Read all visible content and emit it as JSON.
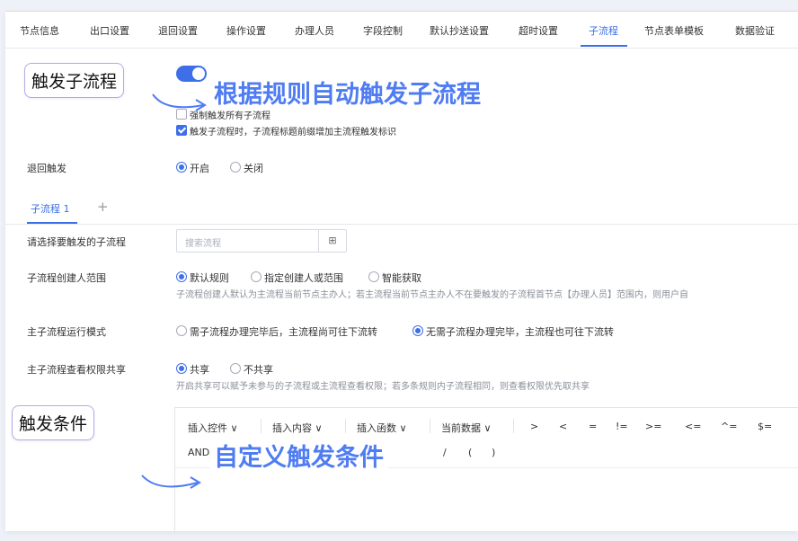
{
  "tabs": [
    "节点信息",
    "出口设置",
    "退回设置",
    "操作设置",
    "办理人员",
    "字段控制",
    "默认抄送设置",
    "超时设置",
    "子流程",
    "节点表单模板",
    "数据验证"
  ],
  "active_tab": "子流程",
  "callout_trigger": "触发子流程",
  "headline_trigger": "根据规则自动触发子流程",
  "options": {
    "force_all": "强制触发所有子流程",
    "prefix_title": "触发子流程时，子流程标题前缀增加主流程触发标识"
  },
  "return_trigger": {
    "label": "退回触发",
    "on": "开启",
    "off": "关闭"
  },
  "subflow_tab": {
    "label": "子流程 1",
    "add": "+"
  },
  "select_subflow": {
    "label": "请选择要触发的子流程",
    "placeholder": "搜索流程",
    "icon": "⊞"
  },
  "creator_range": {
    "label": "子流程创建人范围",
    "opt1": "默认规则",
    "opt2": "指定创建人或范围",
    "opt3": "智能获取",
    "hint": "子流程创建人默认为主流程当前节点主办人；若主流程当前节点主办人不在要触发的子流程首节点【办理人员】范围内，则用户自"
  },
  "run_mode": {
    "label": "主子流程运行模式",
    "opt1": "需子流程办理完毕后，主流程尚可往下流转",
    "opt2": "无需子流程办理完毕，主流程也可往下流转"
  },
  "share": {
    "label": "主子流程查看权限共享",
    "opt1": "共享",
    "opt2": "不共享",
    "hint": "开启共享可以赋予未参与的子流程或主流程查看权限；若多条规则内子流程相同，则查看权限优先取共享"
  },
  "callout_condition": "触发条件",
  "headline_condition": "自定义触发条件",
  "toolbar": {
    "insert_control": "插入控件",
    "insert_content": "插入内容",
    "insert_function": "插入函数",
    "current_data": "当前数据",
    "ops": [
      ">",
      "<",
      "=",
      "!=",
      ">=",
      "<=",
      "^=",
      "$="
    ],
    "row2_and": "AND",
    "row2_ops": [
      "/",
      "(",
      ")"
    ]
  },
  "colors": {
    "accent": "#3b6fe6",
    "headline": "#4f7cf2"
  }
}
